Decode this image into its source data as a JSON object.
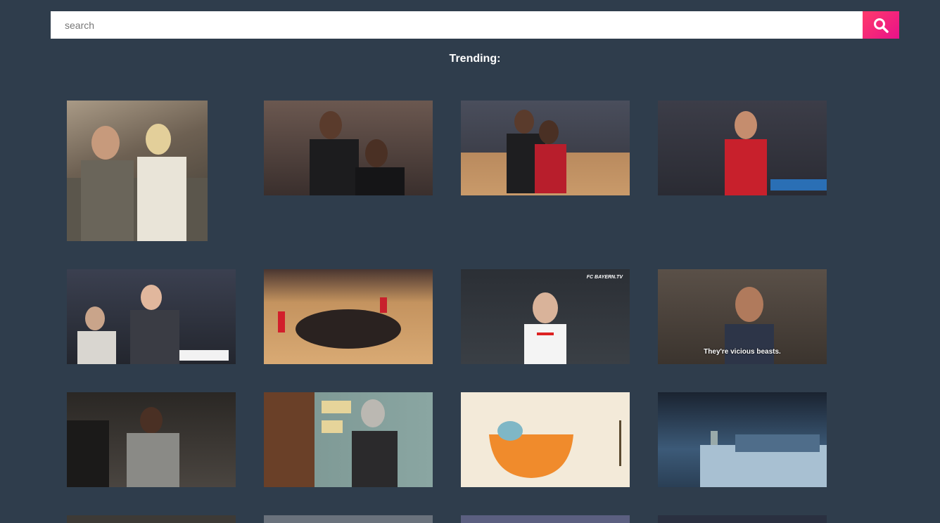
{
  "search": {
    "placeholder": "search"
  },
  "trending": {
    "title": "Trending:"
  },
  "gifs": [
    {
      "id": "gif-1",
      "caption": "",
      "tag": ""
    },
    {
      "id": "gif-2",
      "caption": "",
      "tag": ""
    },
    {
      "id": "gif-3",
      "caption": "",
      "tag": ""
    },
    {
      "id": "gif-4",
      "caption": "",
      "tag": ""
    },
    {
      "id": "gif-5",
      "caption": "",
      "tag": ""
    },
    {
      "id": "gif-6",
      "caption": "",
      "tag": ""
    },
    {
      "id": "gif-7",
      "caption": "",
      "tag": "FC BAYERN.TV"
    },
    {
      "id": "gif-8",
      "caption": "They're vicious beasts.",
      "tag": ""
    },
    {
      "id": "gif-9",
      "caption": "",
      "tag": ""
    },
    {
      "id": "gif-10",
      "caption": "",
      "tag": ""
    },
    {
      "id": "gif-11",
      "caption": "",
      "tag": ""
    },
    {
      "id": "gif-12",
      "caption": "",
      "tag": ""
    }
  ],
  "colors": {
    "background": "#2f3d4c",
    "accent": "#ff2d6f"
  }
}
